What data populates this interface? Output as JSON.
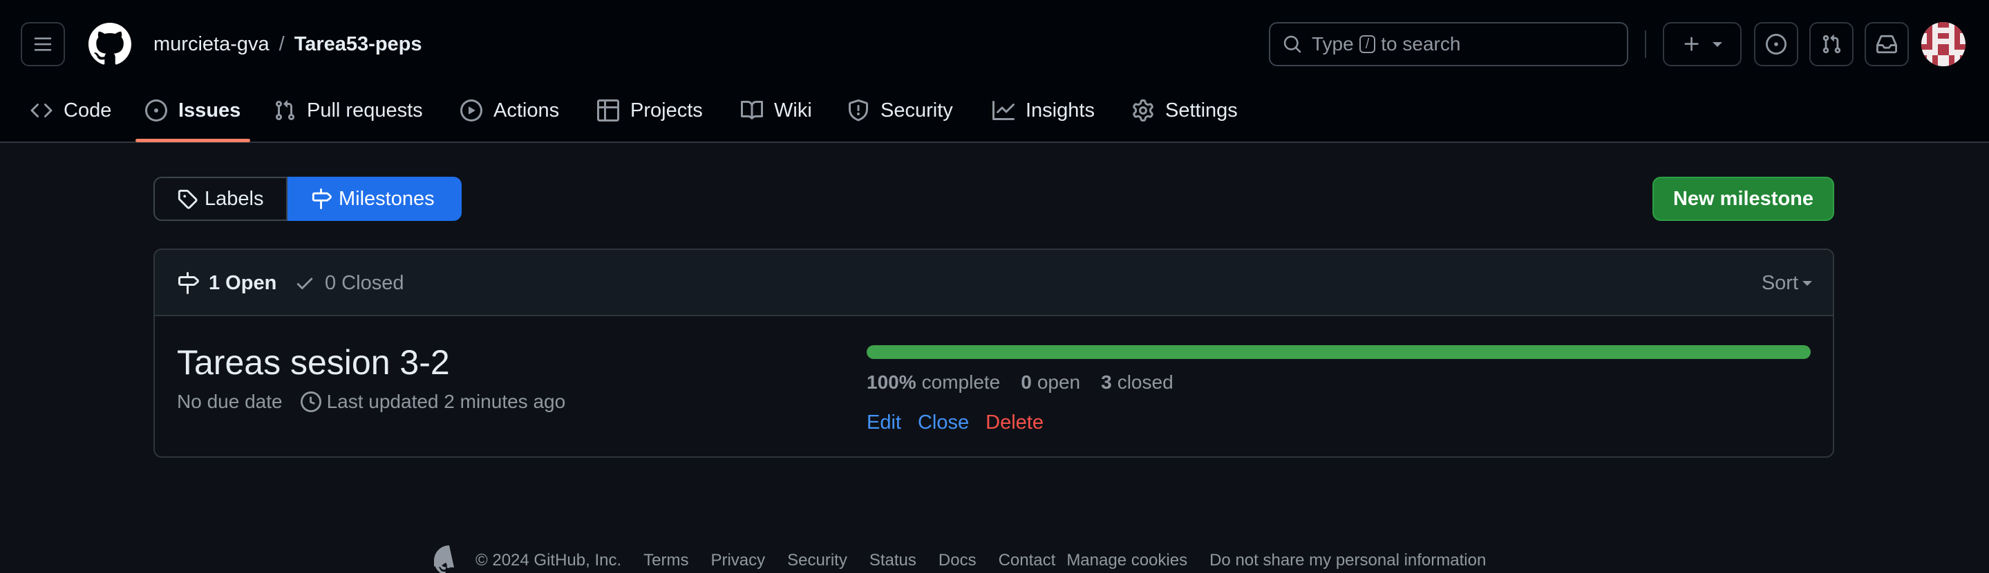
{
  "header": {
    "owner": "murcieta-gva",
    "separator": "/",
    "repo": "Tarea53-peps",
    "search": {
      "prefix": "Type",
      "key": "/",
      "suffix": "to search"
    }
  },
  "repo_nav": {
    "items": [
      {
        "label": "Code",
        "icon": "code-icon"
      },
      {
        "label": "Issues",
        "icon": "issue-opened-icon",
        "active": true
      },
      {
        "label": "Pull requests",
        "icon": "git-pull-request-icon"
      },
      {
        "label": "Actions",
        "icon": "play-icon"
      },
      {
        "label": "Projects",
        "icon": "table-icon"
      },
      {
        "label": "Wiki",
        "icon": "book-icon"
      },
      {
        "label": "Security",
        "icon": "shield-icon"
      },
      {
        "label": "Insights",
        "icon": "graph-icon"
      },
      {
        "label": "Settings",
        "icon": "gear-icon"
      }
    ]
  },
  "subnav": {
    "labels": "Labels",
    "milestones": "Milestones",
    "selected": "Milestones"
  },
  "new_milestone_label": "New milestone",
  "states": {
    "open": "1 Open",
    "closed": "0 Closed",
    "sort": "Sort"
  },
  "milestone": {
    "title": "Tareas sesion 3-2",
    "due": "No due date",
    "updated": "Last updated 2 minutes ago",
    "progress_percent": 100,
    "percent_label": "100%",
    "complete_label": "complete",
    "open_count": "0",
    "open_label": "open",
    "closed_count": "3",
    "closed_label": "closed",
    "actions": {
      "edit": "Edit",
      "close": "Close",
      "delete": "Delete"
    }
  },
  "footer": {
    "copyright": "© 2024 GitHub, Inc.",
    "links": [
      "Terms",
      "Privacy",
      "Security",
      "Status",
      "Docs",
      "Contact",
      "Manage cookies",
      "Do not share my personal information"
    ]
  },
  "colors": {
    "background": "#0d1117",
    "header_background": "#010409",
    "accent_blue": "#1f6feb",
    "primary_green": "#238636",
    "progress_green": "#3fa24c",
    "danger_red": "#f85149",
    "active_tab_underline": "#f78166"
  }
}
